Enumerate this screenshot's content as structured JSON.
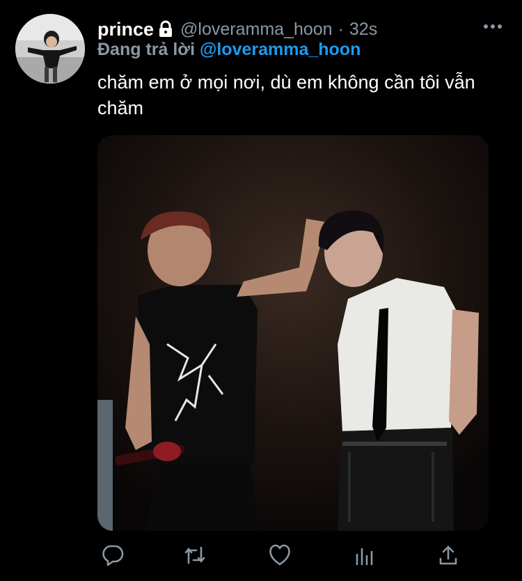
{
  "tweet": {
    "display_name": "prince",
    "handle": "@loveramma_hoon",
    "separator": "·",
    "time": "32s",
    "reply_prefix": "Đang trả lời",
    "reply_handle": "@loveramma_hoon",
    "text": "chăm em ở mọi nơi, dù em không cần tôi vẫn chăm"
  },
  "icons": {
    "lock": "lock-icon",
    "more": "more-icon",
    "reply": "reply-icon",
    "retweet": "retweet-icon",
    "like": "heart-icon",
    "stats": "stats-icon",
    "share": "share-icon"
  },
  "colors": {
    "background": "#000000",
    "text": "#ffffff",
    "secondary": "#8b98a5",
    "link": "#1d9bf0"
  }
}
